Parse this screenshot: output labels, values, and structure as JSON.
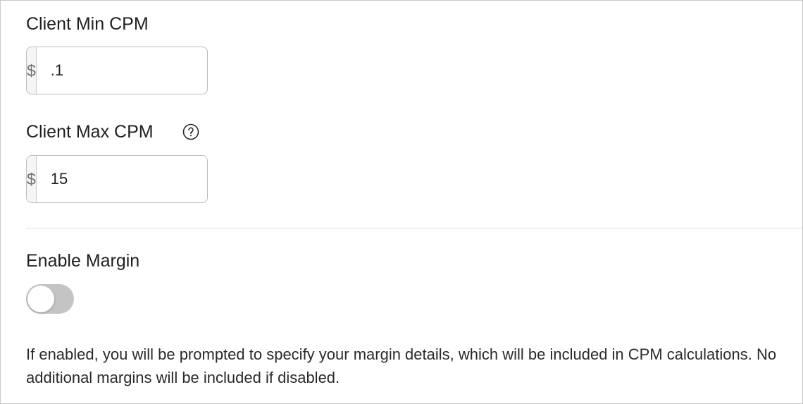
{
  "client_min_cpm": {
    "label": "Client Min CPM",
    "currency_prefix": "$",
    "value": ".1"
  },
  "client_max_cpm": {
    "label": "Client Max CPM",
    "currency_prefix": "$",
    "value": "15",
    "help_icon": "question-circle-icon"
  },
  "enable_margin": {
    "label": "Enable Margin",
    "enabled": false,
    "description": "If enabled, you will be prompted to specify your margin details, which will be included in CPM calculations. No additional margins will be included if disabled."
  },
  "colors": {
    "toggle_off": "#c4c4c4",
    "prefix_bg": "#f5f5f5",
    "border": "#bdbdbd"
  }
}
